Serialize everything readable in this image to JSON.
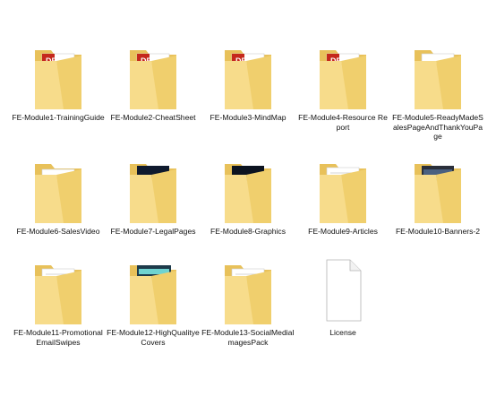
{
  "folder": {
    "colors": {
      "back": "#e8c15a",
      "front": "#f7dc8b",
      "front_shade": "#f0cf6d",
      "paper": "#ffffff",
      "paper_line": "#c8c8c8",
      "pdf_red": "#c5281c"
    }
  },
  "items": [
    {
      "label": "FE-Module1-TrainingGuide",
      "type": "folder",
      "content": "pdf"
    },
    {
      "label": "FE-Module2-CheatSheet",
      "type": "folder",
      "content": "pdf"
    },
    {
      "label": "FE-Module3-MindMap",
      "type": "folder",
      "content": "pdf"
    },
    {
      "label": "FE-Module4-Resource Report",
      "type": "folder",
      "content": "pdf"
    },
    {
      "label": "FE-Module5-ReadyMadeSalesPageAndThankYouPage",
      "type": "folder",
      "content": "firefox"
    },
    {
      "label": "FE-Module6-SalesVideo",
      "type": "folder",
      "content": "blank"
    },
    {
      "label": "FE-Module7-LegalPages",
      "type": "folder",
      "content": "firefox-dark"
    },
    {
      "label": "FE-Module8-Graphics",
      "type": "folder",
      "content": "dark-graphic"
    },
    {
      "label": "FE-Module9-Articles",
      "type": "folder",
      "content": "papers"
    },
    {
      "label": "FE-Module10-Banners-2",
      "type": "folder",
      "content": "banner"
    },
    {
      "label": "FE-Module11-PromotionalEmailSwipes",
      "type": "folder",
      "content": "papers"
    },
    {
      "label": "FE-Module12-HighQualityeCovers",
      "type": "folder",
      "content": "cover"
    },
    {
      "label": "FE-Module13-SocialMediaImagesPack",
      "type": "folder",
      "content": "papers"
    },
    {
      "label": "License",
      "type": "file",
      "content": "document"
    }
  ]
}
